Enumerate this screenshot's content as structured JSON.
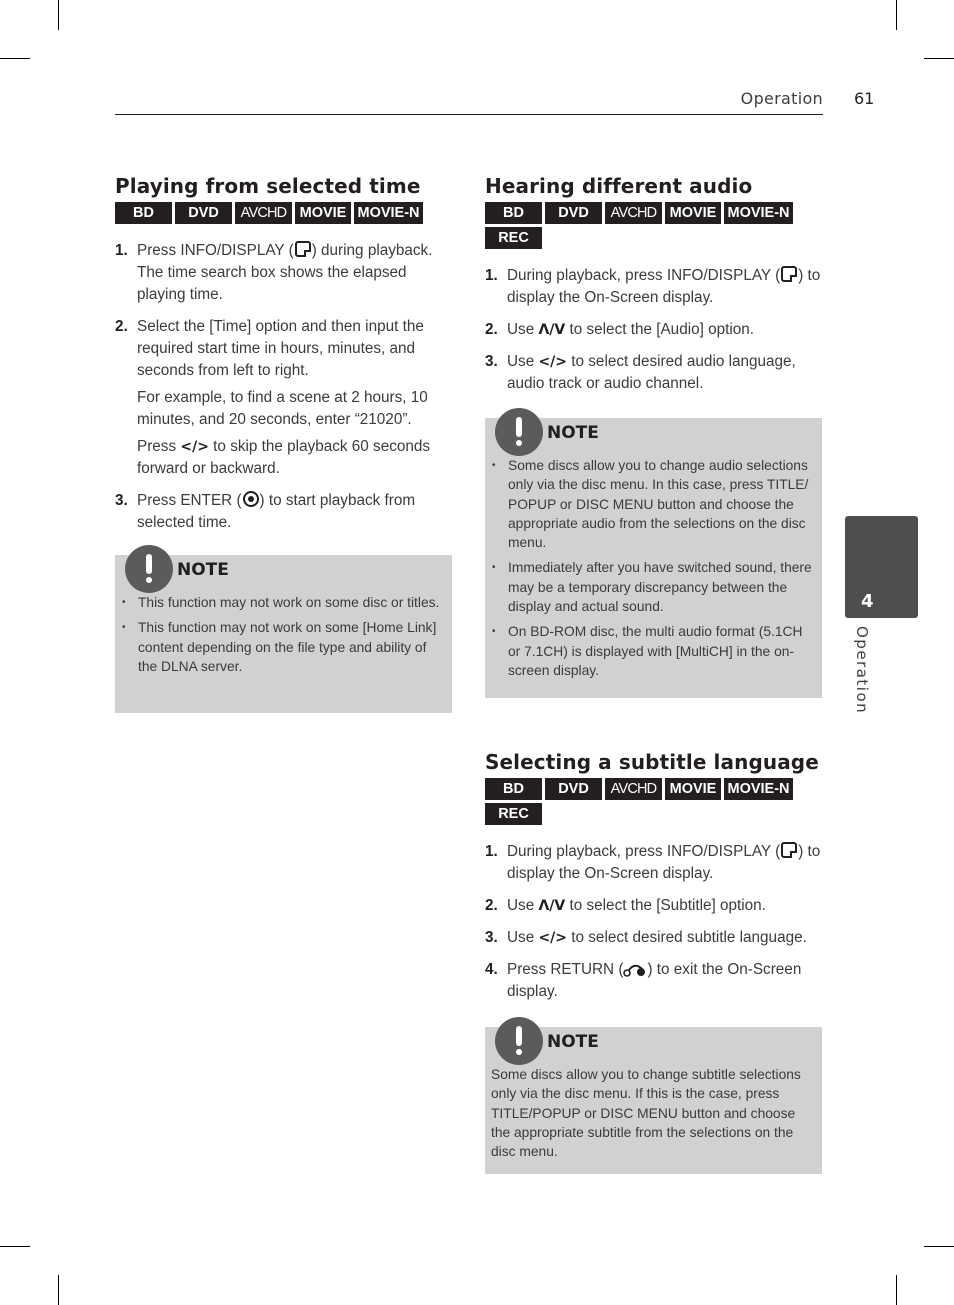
{
  "header": {
    "section": "Operation",
    "page_number": "61"
  },
  "side_tab": {
    "chapter_number": "4",
    "chapter_label": "Operation"
  },
  "sections": {
    "playing_time": {
      "title": "Playing from selected time",
      "badges": [
        "BD",
        "DVD",
        "AVCHD",
        "MOVIE",
        "MOVIE-N"
      ],
      "steps": [
        {
          "num": "1.",
          "pre": "Press INFO/DISPLAY (",
          "icon": "info-display-icon",
          "post": ") during playback. The time search box shows the elapsed playing time."
        },
        {
          "num": "2.",
          "text": "Select the [Time] option and then input the required start time in hours, minutes, and seconds from left to right.",
          "extra1": "For example, to find a scene at 2 hours, 10 minutes, and 20 seconds, enter “21020”.",
          "extra2_pre": "Press ",
          "extra2_sym": "</>",
          "extra2_post": " to skip the playback 60 seconds forward or backward."
        },
        {
          "num": "3.",
          "pre": "Press ENTER (",
          "icon": "enter-icon",
          "post": ") to start playback from selected time."
        }
      ],
      "note": {
        "label": "NOTE",
        "items": [
          "This function may not work on some disc or titles.",
          "This function may not work on some [Home Link] content depending on the file type and ability of the DLNA server."
        ]
      }
    },
    "audio": {
      "title": "Hearing different audio",
      "badges": [
        "BD",
        "DVD",
        "AVCHD",
        "MOVIE",
        "MOVIE-N",
        "REC"
      ],
      "steps": [
        {
          "num": "1.",
          "pre": "During playback, press INFO/DISPLAY (",
          "icon": "info-display-icon",
          "post": ") to display the On-Screen display."
        },
        {
          "num": "2.",
          "pre": "Use ",
          "sym": "Λ/V",
          "post": " to select the [Audio] option."
        },
        {
          "num": "3.",
          "pre": "Use ",
          "sym": "</>",
          "post": " to select desired audio language, audio track or audio channel."
        }
      ],
      "note": {
        "label": "NOTE",
        "items": [
          "Some discs allow you to change audio selections only via the disc menu. In this case, press TITLE/ POPUP or DISC MENU button and choose the appropriate audio from the selections on the disc menu.",
          "Immediately after you have switched sound, there may be a temporary discrepancy between the display and actual sound.",
          "On BD-ROM disc, the multi audio format (5.1CH or 7.1CH) is displayed with [MultiCH] in the on-screen display."
        ]
      }
    },
    "subtitle": {
      "title": "Selecting a subtitle language",
      "badges": [
        "BD",
        "DVD",
        "AVCHD",
        "MOVIE",
        "MOVIE-N",
        "REC"
      ],
      "steps": [
        {
          "num": "1.",
          "pre": "During playback, press INFO/DISPLAY (",
          "icon": "info-display-icon",
          "post": ") to display the On-Screen display."
        },
        {
          "num": "2.",
          "pre": "Use ",
          "sym": "Λ/V",
          "post": " to select the [Subtitle] option."
        },
        {
          "num": "3.",
          "pre": "Use ",
          "sym": "</>",
          "post": " to select desired subtitle language."
        },
        {
          "num": "4.",
          "pre": "Press RETURN (",
          "icon": "return-icon",
          "post": ") to exit the On-Screen display."
        }
      ],
      "note": {
        "label": "NOTE",
        "text": "Some discs allow you to change subtitle selections only via the disc menu. If this is the case, press TITLE/POPUP or DISC MENU button and choose the appropriate subtitle from the selections on the disc menu."
      }
    }
  }
}
